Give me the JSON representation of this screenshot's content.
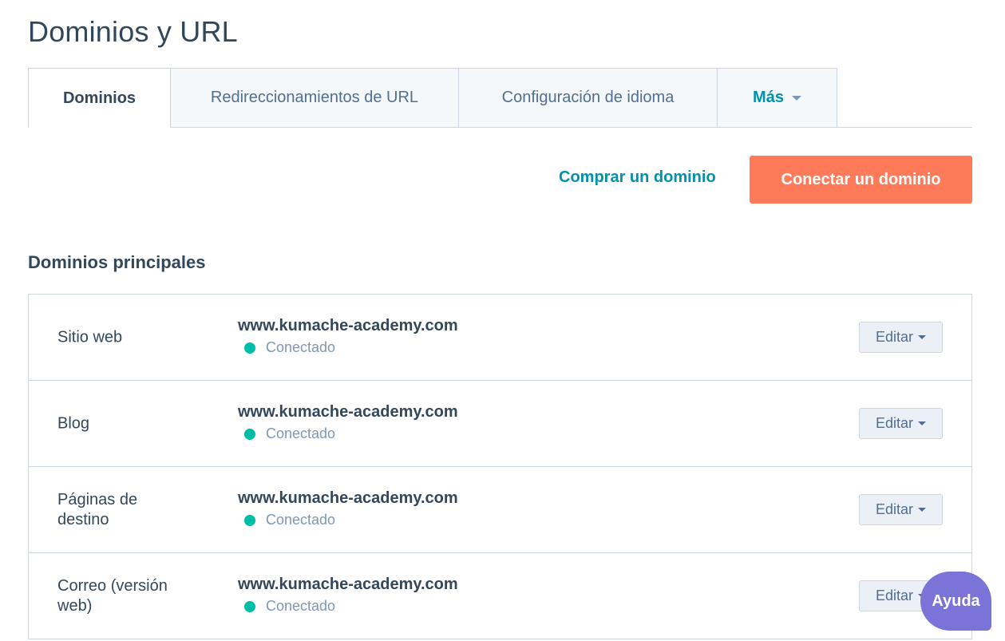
{
  "page": {
    "title": "Dominios y URL"
  },
  "tabs": [
    {
      "label": "Dominios",
      "active": true
    },
    {
      "label": "Redireccionamientos de URL",
      "active": false
    },
    {
      "label": "Configuración de idioma",
      "active": false
    },
    {
      "label": "Más",
      "active": false
    }
  ],
  "actions": {
    "buy_label": "Comprar un dominio",
    "connect_label": "Conectar un dominio"
  },
  "section": {
    "heading": "Dominios principales"
  },
  "rows": [
    {
      "label": "Sitio web",
      "domain": "www.kumache-academy.com",
      "status": "Conectado",
      "edit_label": "Editar"
    },
    {
      "label": "Blog",
      "domain": "www.kumache-academy.com",
      "status": "Conectado",
      "edit_label": "Editar"
    },
    {
      "label": "Páginas de destino",
      "domain": "www.kumache-academy.com",
      "status": "Conectado",
      "edit_label": "Editar"
    },
    {
      "label": "Correo (versión web)",
      "domain": "www.kumache-academy.com",
      "status": "Conectado",
      "edit_label": "Editar"
    }
  ],
  "help": {
    "label": "Ayuda"
  },
  "colors": {
    "accent": "#0091ae",
    "primary_button": "#ff7a59",
    "status_connected": "#00bda5",
    "help_button": "#7a73d8"
  },
  "icons": {
    "tab_more_caret": "chevron-down-icon",
    "edit_caret": "chevron-down-icon",
    "status": "status-dot-icon"
  }
}
